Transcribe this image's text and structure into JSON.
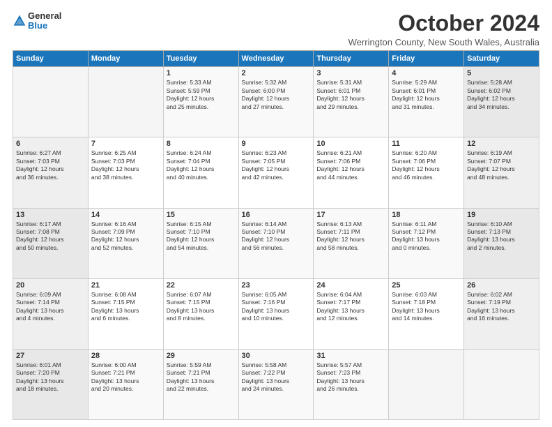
{
  "logo": {
    "general": "General",
    "blue": "Blue"
  },
  "header": {
    "month_title": "October 2024",
    "subtitle": "Werrington County, New South Wales, Australia"
  },
  "weekdays": [
    "Sunday",
    "Monday",
    "Tuesday",
    "Wednesday",
    "Thursday",
    "Friday",
    "Saturday"
  ],
  "weeks": [
    [
      {
        "day": "",
        "info": ""
      },
      {
        "day": "",
        "info": ""
      },
      {
        "day": "1",
        "info": "Sunrise: 5:33 AM\nSunset: 5:59 PM\nDaylight: 12 hours\nand 25 minutes."
      },
      {
        "day": "2",
        "info": "Sunrise: 5:32 AM\nSunset: 6:00 PM\nDaylight: 12 hours\nand 27 minutes."
      },
      {
        "day": "3",
        "info": "Sunrise: 5:31 AM\nSunset: 6:01 PM\nDaylight: 12 hours\nand 29 minutes."
      },
      {
        "day": "4",
        "info": "Sunrise: 5:29 AM\nSunset: 6:01 PM\nDaylight: 12 hours\nand 31 minutes."
      },
      {
        "day": "5",
        "info": "Sunrise: 5:28 AM\nSunset: 6:02 PM\nDaylight: 12 hours\nand 34 minutes."
      }
    ],
    [
      {
        "day": "6",
        "info": "Sunrise: 6:27 AM\nSunset: 7:03 PM\nDaylight: 12 hours\nand 36 minutes."
      },
      {
        "day": "7",
        "info": "Sunrise: 6:25 AM\nSunset: 7:03 PM\nDaylight: 12 hours\nand 38 minutes."
      },
      {
        "day": "8",
        "info": "Sunrise: 6:24 AM\nSunset: 7:04 PM\nDaylight: 12 hours\nand 40 minutes."
      },
      {
        "day": "9",
        "info": "Sunrise: 6:23 AM\nSunset: 7:05 PM\nDaylight: 12 hours\nand 42 minutes."
      },
      {
        "day": "10",
        "info": "Sunrise: 6:21 AM\nSunset: 7:06 PM\nDaylight: 12 hours\nand 44 minutes."
      },
      {
        "day": "11",
        "info": "Sunrise: 6:20 AM\nSunset: 7:06 PM\nDaylight: 12 hours\nand 46 minutes."
      },
      {
        "day": "12",
        "info": "Sunrise: 6:19 AM\nSunset: 7:07 PM\nDaylight: 12 hours\nand 48 minutes."
      }
    ],
    [
      {
        "day": "13",
        "info": "Sunrise: 6:17 AM\nSunset: 7:08 PM\nDaylight: 12 hours\nand 50 minutes."
      },
      {
        "day": "14",
        "info": "Sunrise: 6:16 AM\nSunset: 7:09 PM\nDaylight: 12 hours\nand 52 minutes."
      },
      {
        "day": "15",
        "info": "Sunrise: 6:15 AM\nSunset: 7:10 PM\nDaylight: 12 hours\nand 54 minutes."
      },
      {
        "day": "16",
        "info": "Sunrise: 6:14 AM\nSunset: 7:10 PM\nDaylight: 12 hours\nand 56 minutes."
      },
      {
        "day": "17",
        "info": "Sunrise: 6:13 AM\nSunset: 7:11 PM\nDaylight: 12 hours\nand 58 minutes."
      },
      {
        "day": "18",
        "info": "Sunrise: 6:11 AM\nSunset: 7:12 PM\nDaylight: 13 hours\nand 0 minutes."
      },
      {
        "day": "19",
        "info": "Sunrise: 6:10 AM\nSunset: 7:13 PM\nDaylight: 13 hours\nand 2 minutes."
      }
    ],
    [
      {
        "day": "20",
        "info": "Sunrise: 6:09 AM\nSunset: 7:14 PM\nDaylight: 13 hours\nand 4 minutes."
      },
      {
        "day": "21",
        "info": "Sunrise: 6:08 AM\nSunset: 7:15 PM\nDaylight: 13 hours\nand 6 minutes."
      },
      {
        "day": "22",
        "info": "Sunrise: 6:07 AM\nSunset: 7:15 PM\nDaylight: 13 hours\nand 8 minutes."
      },
      {
        "day": "23",
        "info": "Sunrise: 6:05 AM\nSunset: 7:16 PM\nDaylight: 13 hours\nand 10 minutes."
      },
      {
        "day": "24",
        "info": "Sunrise: 6:04 AM\nSunset: 7:17 PM\nDaylight: 13 hours\nand 12 minutes."
      },
      {
        "day": "25",
        "info": "Sunrise: 6:03 AM\nSunset: 7:18 PM\nDaylight: 13 hours\nand 14 minutes."
      },
      {
        "day": "26",
        "info": "Sunrise: 6:02 AM\nSunset: 7:19 PM\nDaylight: 13 hours\nand 16 minutes."
      }
    ],
    [
      {
        "day": "27",
        "info": "Sunrise: 6:01 AM\nSunset: 7:20 PM\nDaylight: 13 hours\nand 18 minutes."
      },
      {
        "day": "28",
        "info": "Sunrise: 6:00 AM\nSunset: 7:21 PM\nDaylight: 13 hours\nand 20 minutes."
      },
      {
        "day": "29",
        "info": "Sunrise: 5:59 AM\nSunset: 7:21 PM\nDaylight: 13 hours\nand 22 minutes."
      },
      {
        "day": "30",
        "info": "Sunrise: 5:58 AM\nSunset: 7:22 PM\nDaylight: 13 hours\nand 24 minutes."
      },
      {
        "day": "31",
        "info": "Sunrise: 5:57 AM\nSunset: 7:23 PM\nDaylight: 13 hours\nand 26 minutes."
      },
      {
        "day": "",
        "info": ""
      },
      {
        "day": "",
        "info": ""
      }
    ]
  ]
}
